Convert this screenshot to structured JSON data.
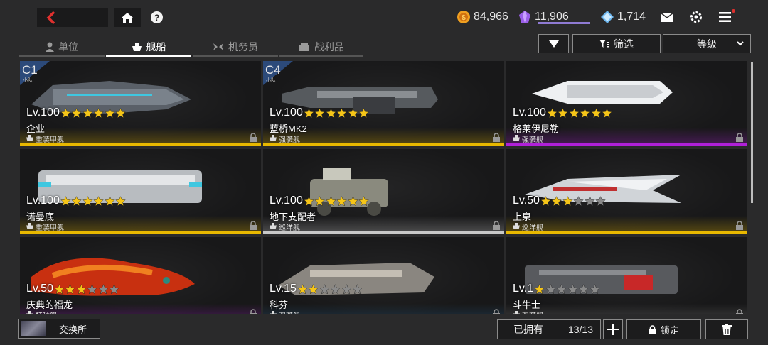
{
  "header": {
    "back_icon": "chevron-left-icon",
    "home_icon": "home-icon",
    "help_label": "?",
    "resources": [
      {
        "icon": "gold-coin-icon",
        "value": "84,966",
        "color": "#f0a020"
      },
      {
        "icon": "purple-crystal-icon",
        "value": "11,906",
        "color": "#9a5ee8"
      },
      {
        "icon": "blue-diamond-icon",
        "value": "1,714",
        "color": "#6fb8f0"
      }
    ],
    "crystal_progress": 1.0
  },
  "tabs": [
    {
      "label": "单位",
      "icon": "pilot-icon",
      "active": false
    },
    {
      "label": "舰船",
      "icon": "ship-icon",
      "active": true
    },
    {
      "label": "机务员",
      "icon": "wings-icon",
      "active": false
    },
    {
      "label": "战利品",
      "icon": "crate-icon",
      "active": false
    }
  ],
  "toolbar": {
    "filter_label": "筛选",
    "sort_label": "等级"
  },
  "ships": [
    {
      "badge": "C1",
      "badge_sub": "小队",
      "level": "Lv.100",
      "stars": 6,
      "name": "企业",
      "type": "重装甲舰",
      "rarity_color": "#e8b800"
    },
    {
      "badge": "C4",
      "badge_sub": "小队",
      "level": "Lv.100",
      "stars": 6,
      "name": "蓝桥MK2",
      "type": "强袭舰",
      "rarity_color": "#e8b800"
    },
    {
      "badge": "",
      "badge_sub": "",
      "level": "Lv.100",
      "stars": 6,
      "name": "格莱伊尼勒",
      "type": "强袭舰",
      "rarity_color": "#b020d8"
    },
    {
      "badge": "",
      "badge_sub": "",
      "level": "Lv.100",
      "stars": 6,
      "name": "诺曼底",
      "type": "重装甲舰",
      "rarity_color": "#e8b800"
    },
    {
      "badge": "",
      "badge_sub": "",
      "level": "Lv.100",
      "stars": 6,
      "name": "地下支配者",
      "type": "巡洋舰",
      "rarity_color": "#c8c8c8"
    },
    {
      "badge": "",
      "badge_sub": "",
      "level": "Lv.50",
      "stars": 3,
      "name": "上泉",
      "type": "巡洋舰",
      "rarity_color": "#e8b800"
    },
    {
      "badge": "",
      "badge_sub": "",
      "level": "Lv.50",
      "stars": 3,
      "name": "庆典的福龙",
      "type": "特种舰",
      "rarity_color": "#b020d8"
    },
    {
      "badge": "",
      "badge_sub": "",
      "level": "Lv.15",
      "stars": 2,
      "name": "科芬",
      "type": "强袭舰",
      "rarity_color": "#2a6a9a"
    },
    {
      "badge": "",
      "badge_sub": "",
      "level": "Lv.1",
      "stars": 1,
      "name": "斗牛士",
      "type": "强袭舰",
      "rarity_color": "#8a8a8a"
    }
  ],
  "footer": {
    "exchange_label": "交换所",
    "owned_label": "已拥有",
    "owned_count": "13/13",
    "lock_label": "锁定"
  }
}
